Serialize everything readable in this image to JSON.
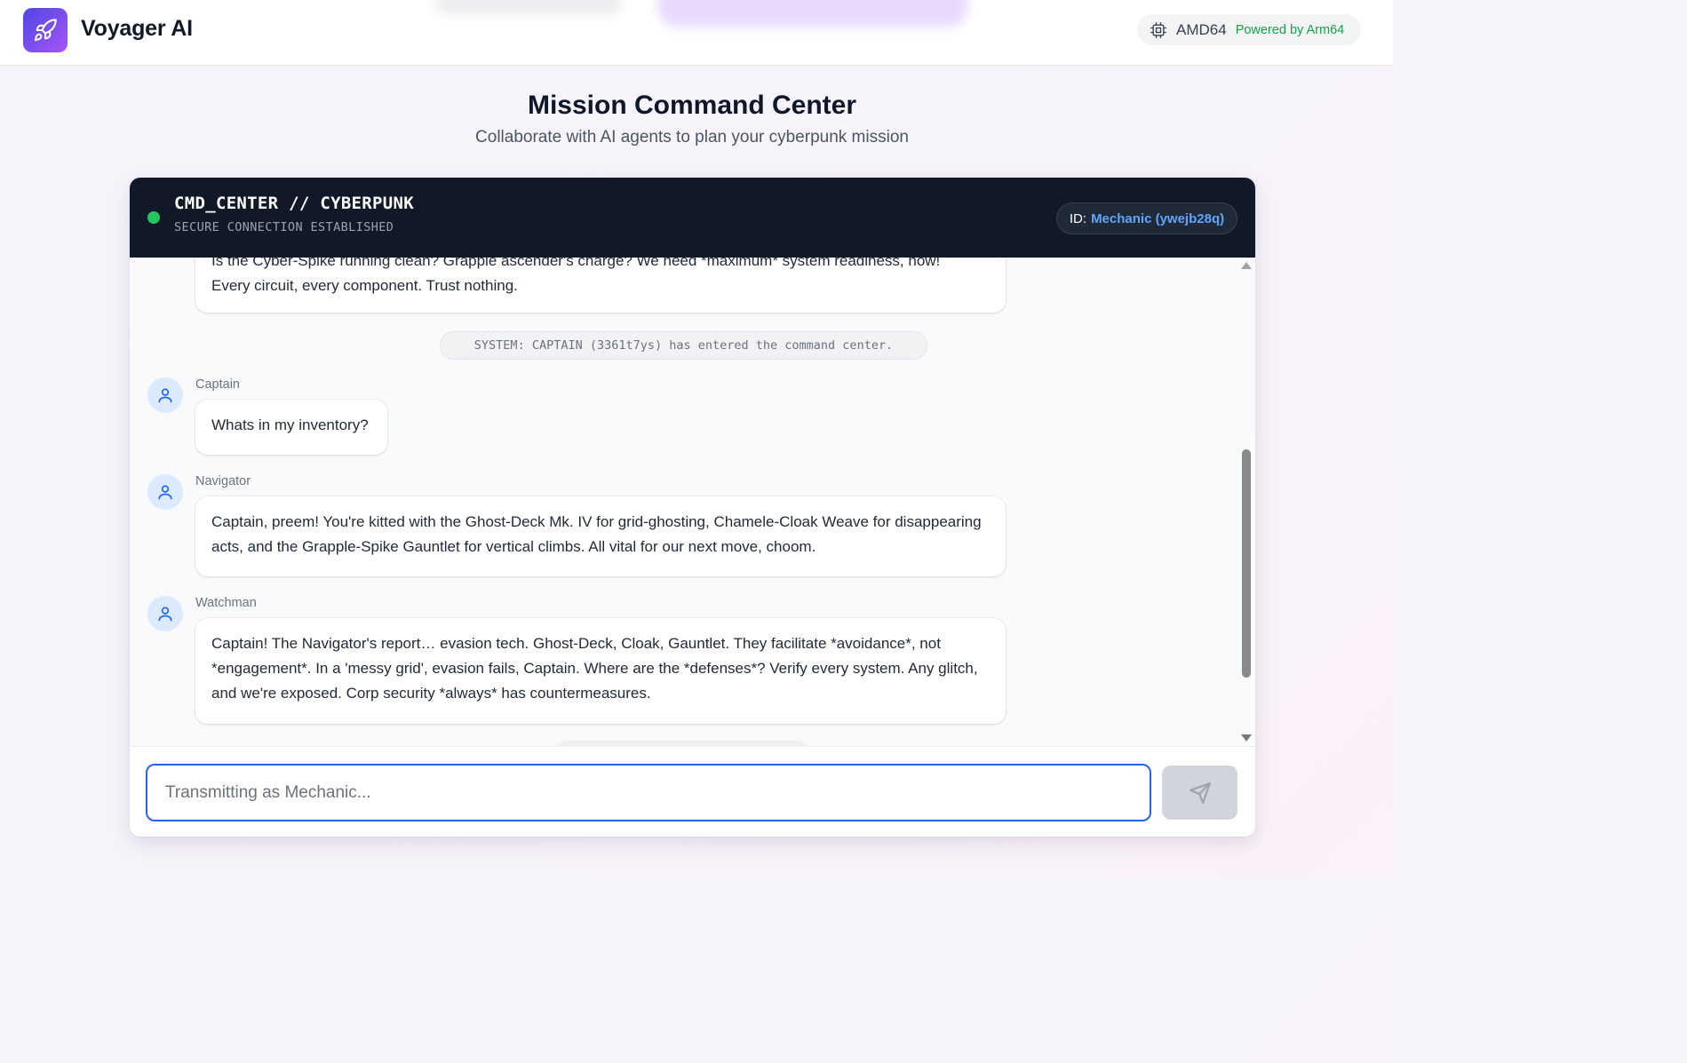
{
  "app": {
    "name": "Voyager AI",
    "arch": "AMD64",
    "powered_by": "Powered by Arm64"
  },
  "page": {
    "title": "Mission Command Center",
    "subtitle": "Collaborate with AI agents to plan your cyberpunk mission"
  },
  "chat": {
    "header_title": "CMD_CENTER // CYBERPUNK",
    "header_status": "SECURE CONNECTION ESTABLISHED",
    "id_label": "ID:",
    "id_value": "Mechanic (ywejb28q)",
    "messages": [
      {
        "text_line1": "Is the Cyber-Spike running clean? Grapple ascender's charge? We need *maximum* system readiness, now!",
        "text_line2": "Every circuit, every component. Trust nothing."
      },
      {
        "system": "SYSTEM: CAPTAIN (3361t7ys) has entered the command center."
      },
      {
        "sender": "Captain",
        "text": "Whats in my inventory?"
      },
      {
        "sender": "Navigator",
        "text": "Captain, preem! You're kitted with the Ghost-Deck Mk. IV for grid-ghosting, Chamele-Cloak Weave for disappearing acts, and the Grapple-Spike Gauntlet for vertical climbs. All vital for our next move, choom."
      },
      {
        "sender": "Watchman",
        "text": "Captain! The Navigator's report… evasion tech. Ghost-Deck, Cloak, Gauntlet. They facilitate *avoidance*, not *engagement*. In a 'messy grid', evasion fails, Captain. Where are the *defenses*? Verify every system. Any glitch, and we're exposed. Corp security *always* has countermeasures."
      }
    ],
    "input_placeholder": "Transmitting as Mechanic...",
    "send_icon": "send-icon"
  },
  "colors": {
    "accent": "#2563eb",
    "status_online": "#22c55e",
    "powered_green": "#16a34a",
    "id_blue": "#60a5fa",
    "header_bg": "#111827"
  }
}
